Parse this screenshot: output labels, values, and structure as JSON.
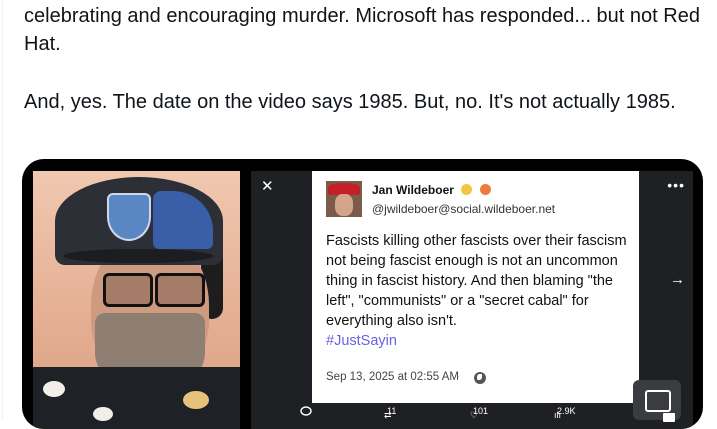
{
  "post": {
    "line1": "celebrating and encouraging murder.  Microsoft has responded... but not Red Hat.",
    "line2": "And, yes.  The date on the video says 1985.  But, no.  It's not actually 1985."
  },
  "toot": {
    "author": "Jan Wildeboer",
    "handle": "@jwildeboer@social.wildeboer.net",
    "body": "Fascists killing other fascists over their fascism not being fascist enough is not an uncommon thing in fascist history. And then blaming \"the left\", \"communists\" or a \"secret cabal\" for everything also isn't.",
    "hashtag": "#JustSayin",
    "timestamp": "Sep 13, 2025 at 02:55 AM",
    "separator": "·"
  },
  "overlay": {
    "close_glyph": "✕",
    "more_glyph": "•••",
    "next_glyph": "→"
  },
  "actions": {
    "reply_icon": "reply-icon",
    "retweets": "11",
    "likes": "101",
    "views": "2.9K"
  },
  "icons": [
    "close-icon",
    "more-icon",
    "next-arrow-icon",
    "globe-icon",
    "pip-icon",
    "reply-icon",
    "retweet-icon",
    "like-icon",
    "views-icon"
  ],
  "colors": {
    "hashtag": "#6b62e0",
    "card_bg": "#000000"
  }
}
